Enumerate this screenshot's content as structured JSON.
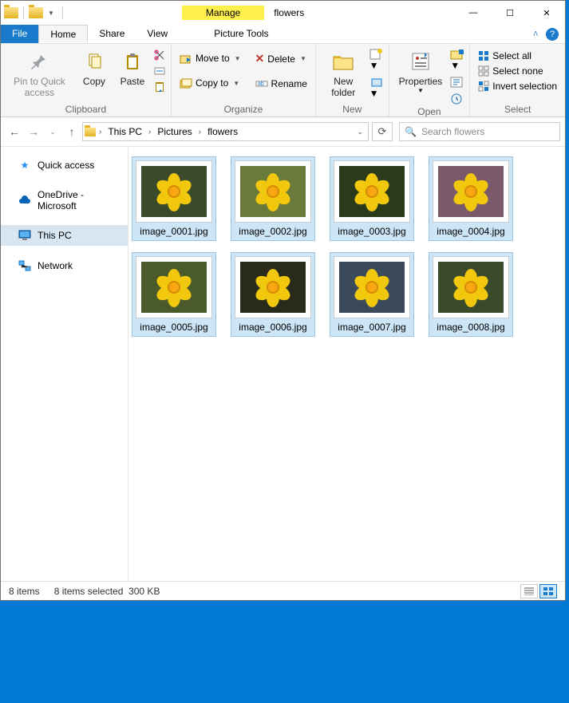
{
  "title": "flowers",
  "contextual_tab": "Manage",
  "contextual_subtab": "Picture Tools",
  "tabs": {
    "file": "File",
    "home": "Home",
    "share": "Share",
    "view": "View"
  },
  "ribbon": {
    "clipboard": {
      "label": "Clipboard",
      "pin": "Pin to Quick access",
      "copy": "Copy",
      "paste": "Paste"
    },
    "organize": {
      "label": "Organize",
      "move_to": "Move to",
      "copy_to": "Copy to",
      "delete": "Delete",
      "rename": "Rename"
    },
    "new": {
      "label": "New",
      "new_folder": "New folder"
    },
    "open": {
      "label": "Open",
      "properties": "Properties"
    },
    "select": {
      "label": "Select",
      "select_all": "Select all",
      "select_none": "Select none",
      "invert": "Invert selection"
    }
  },
  "breadcrumbs": [
    "This PC",
    "Pictures",
    "flowers"
  ],
  "search_placeholder": "Search flowers",
  "nav": {
    "quick_access": "Quick access",
    "onedrive": "OneDrive - Microsoft",
    "this_pc": "This PC",
    "network": "Network"
  },
  "files": [
    {
      "name": "image_0001.jpg",
      "bg": "#3a4a2a"
    },
    {
      "name": "image_0002.jpg",
      "bg": "#6a7a3a"
    },
    {
      "name": "image_0003.jpg",
      "bg": "#2a3a1a"
    },
    {
      "name": "image_0004.jpg",
      "bg": "#7a5a6a"
    },
    {
      "name": "image_0005.jpg",
      "bg": "#4a5a2a"
    },
    {
      "name": "image_0006.jpg",
      "bg": "#2a2a1a"
    },
    {
      "name": "image_0007.jpg",
      "bg": "#3a4a5a"
    },
    {
      "name": "image_0008.jpg",
      "bg": "#3a4a2a"
    }
  ],
  "status": {
    "count": "8 items",
    "selection": "8 items selected",
    "size": "300 KB"
  }
}
